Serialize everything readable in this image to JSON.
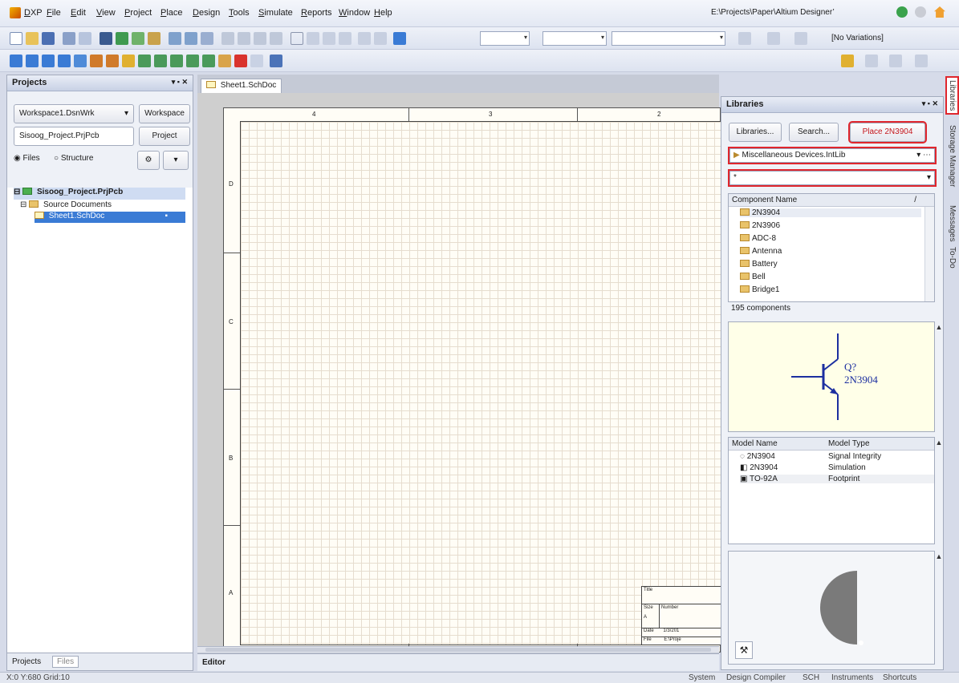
{
  "menubar": {
    "items": [
      "DXP",
      "File",
      "Edit",
      "View",
      "Project",
      "Place",
      "Design",
      "Tools",
      "Simulate",
      "Reports",
      "Window",
      "Help"
    ],
    "path": "E:\\Projects\\Paper\\Altium Designer’"
  },
  "toolbar": {
    "variations": "[No Variations]"
  },
  "projects_panel": {
    "title": "Projects",
    "workspace_select": "Workspace1.DsnWrk",
    "workspace_button": "Workspace",
    "project_field": "Sisoog_Project.PrjPcb",
    "project_button": "Project",
    "radio_files": "Files",
    "radio_structure": "Structure",
    "tree_project": "Sisoog_Project.PrjPcb",
    "tree_folder": "Source Documents",
    "tree_doc": "Sheet1.SchDoc",
    "bottom_tabs": [
      "Projects",
      "Files"
    ]
  },
  "editor": {
    "tab": "Sheet1.SchDoc",
    "bottom_tab": "Editor",
    "col_markers": [
      "4",
      "3",
      "2"
    ],
    "row_markers": [
      "D",
      "C",
      "B",
      "A"
    ],
    "title_block": {
      "title": "Title",
      "size": "Size",
      "size_value": "A",
      "number": "Number",
      "date": "Date",
      "file": "File",
      "date_value": "1/3/201",
      "file_value": "E:\\Proje"
    }
  },
  "libraries_panel": {
    "title": "Libraries",
    "libraries_button": "Libraries...",
    "search_button": "Search...",
    "place_button": "Place 2N3904",
    "library_select": "Miscellaneous Devices.IntLib",
    "filter_value": "*",
    "component_header": "Component Name",
    "components": [
      "2N3904",
      "2N3906",
      "ADC-8",
      "Antenna",
      "Battery",
      "Bell",
      "Bridge1"
    ],
    "count": "195 components",
    "preview_designator": "Q?",
    "preview_part": "2N3904",
    "model_header_name": "Model Name",
    "model_header_type": "Model Type",
    "models": [
      {
        "name": "2N3904",
        "type": "Signal Integrity"
      },
      {
        "name": "2N3904",
        "type": "Simulation"
      },
      {
        "name": "TO-92A",
        "type": "Footprint"
      }
    ]
  },
  "side_tabs": [
    "Libraries",
    "Storage Manager",
    "Messages",
    "To-Do"
  ],
  "statusbar": {
    "coords": "X:0 Y:680   Grid:10",
    "right": [
      "System",
      "Design Compiler",
      "SCH",
      "Instruments",
      "Shortcuts"
    ]
  },
  "colors": {
    "highlight": "#e0262d",
    "grid": "#e6ddcf",
    "sheet": "#fffdf6",
    "accent": "#3a7bd5"
  }
}
